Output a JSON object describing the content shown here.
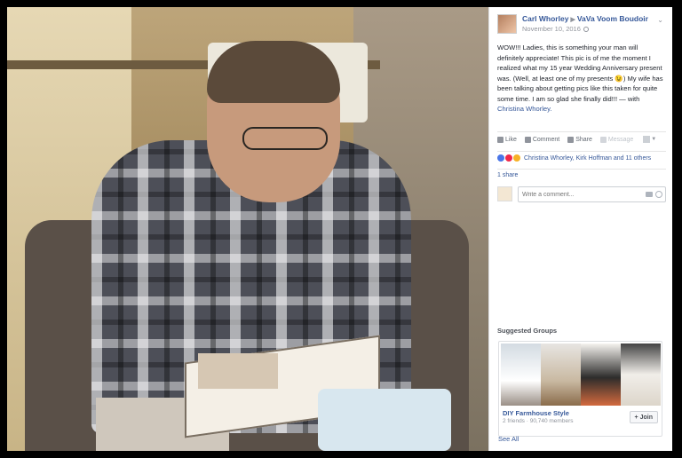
{
  "post": {
    "author": "Carl Whorley",
    "group": "VaVa Voom Boudoir",
    "date": "November 10, 2016",
    "text": "WOW!!! Ladies, this is something your man will definitely appreciate! This pic is of me the moment I realized what my 15 year Wedding Anniversary present was. (Well, at least one of my presents 😉) My wife has been talking about getting pics like this taken for quite some time. I am so glad she finally did!!! — with",
    "tagged": "Christina Whorley."
  },
  "actions": {
    "like": "Like",
    "comment": "Comment",
    "share": "Share",
    "message": "Message"
  },
  "reactions": {
    "summary": "Christina Whorley, Kirk Hoffman and 11 others"
  },
  "shares": {
    "label": "1 share"
  },
  "comment_box": {
    "placeholder": "Write a comment..."
  },
  "suggested": {
    "heading": "Suggested Groups",
    "group_name": "DIY Farmhouse Style",
    "group_meta": "2 friends · 90,740 members",
    "join": "Join",
    "see_all": "See All"
  },
  "colors": {
    "link": "#365899",
    "text": "#1d2129",
    "muted": "#90949c"
  }
}
